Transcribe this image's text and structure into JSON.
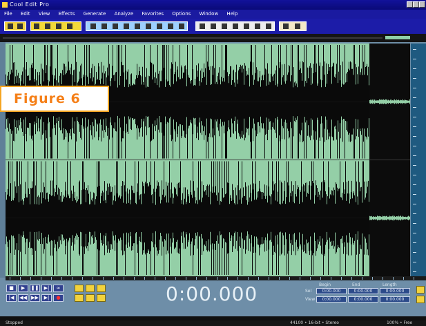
{
  "window": {
    "title": "Cool Edit Pro"
  },
  "menu": [
    "File",
    "Edit",
    "View",
    "Effects",
    "Generate",
    "Analyze",
    "Favorites",
    "Options",
    "Window",
    "Help"
  ],
  "figure_label": "Figure 6",
  "transport": {
    "time": "0:00.000",
    "buttons": [
      "stop",
      "play",
      "pause",
      "play-to-end",
      "loop",
      "go-start",
      "rewind",
      "fast-forward",
      "go-end",
      "record"
    ]
  },
  "selection": {
    "headers": [
      "Begin",
      "End",
      "Length"
    ],
    "rows": [
      {
        "label": "Sel",
        "values": [
          "0:00.000",
          "0:00.000",
          "0:00.000"
        ]
      },
      {
        "label": "View",
        "values": [
          "0:00.000",
          "0:00.000",
          "0:00.000"
        ]
      }
    ]
  },
  "status": {
    "left": "Stopped",
    "mid": "44100 • 16-bit • Stereo",
    "right": "100% • Free"
  },
  "colors": {
    "waveform_bg": "#94cfa7",
    "waveform": "#0a0a0a",
    "window_blue": "#1c1ca8",
    "timecode": "#e7f0f6",
    "figure_label": "#f57f17"
  },
  "waveform": {
    "signal_end_fraction": 0.9,
    "upper_channel_level": 0.7,
    "lower_channel_level": 0.65
  }
}
